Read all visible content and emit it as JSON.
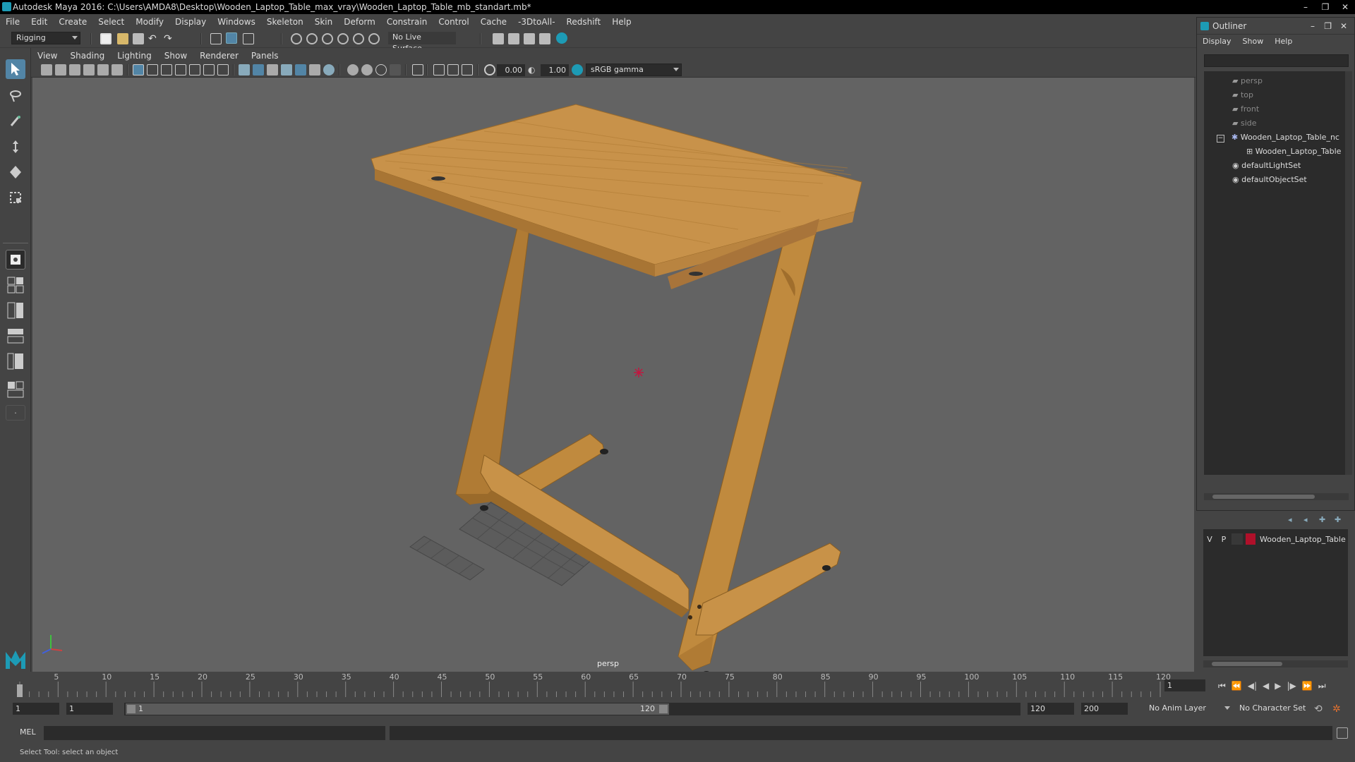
{
  "window": {
    "title": "Autodesk Maya 2016: C:\\Users\\AMDA8\\Desktop\\Wooden_Laptop_Table_max_vray\\Wooden_Laptop_Table_mb_standart.mb*",
    "minimize": "–",
    "maximize": "❐",
    "close": "✕"
  },
  "menubar": [
    "File",
    "Edit",
    "Create",
    "Select",
    "Modify",
    "Display",
    "Windows",
    "Skeleton",
    "Skin",
    "Deform",
    "Constrain",
    "Control",
    "Cache",
    "-3DtoAll-",
    "Redshift",
    "Help"
  ],
  "statusline": {
    "menu_set": "Rigging",
    "live_surface": "No Live Surface"
  },
  "viewport": {
    "menu": [
      "View",
      "Shading",
      "Lighting",
      "Show",
      "Renderer",
      "Panels"
    ],
    "exposure": "0.00",
    "gamma": "1.00",
    "color_space": "sRGB gamma",
    "camera_label": "persp"
  },
  "outliner": {
    "title": "Outliner",
    "menu": [
      "Display",
      "Show",
      "Help"
    ],
    "items": [
      {
        "label": "persp",
        "icon": "camera-icon",
        "dim": true
      },
      {
        "label": "top",
        "icon": "camera-icon",
        "dim": true
      },
      {
        "label": "front",
        "icon": "camera-icon",
        "dim": true
      },
      {
        "label": "side",
        "icon": "camera-icon",
        "dim": true
      },
      {
        "label": "Wooden_Laptop_Table_nc",
        "icon": "group-icon",
        "dim": false
      },
      {
        "label": "Wooden_Laptop_Table",
        "icon": "mesh-icon",
        "dim": false
      },
      {
        "label": "defaultLightSet",
        "icon": "set-icon",
        "dim": false
      },
      {
        "label": "defaultObjectSet",
        "icon": "set-icon",
        "dim": false
      }
    ]
  },
  "layers": {
    "v": "V",
    "p": "P",
    "layer_name": "Wooden_Laptop_Table",
    "layer_color": "#b0102a"
  },
  "timeslider": {
    "ticks": [
      "1",
      "5",
      "10",
      "15",
      "20",
      "25",
      "30",
      "35",
      "40",
      "45",
      "50",
      "55",
      "60",
      "65",
      "70",
      "75",
      "80",
      "85",
      "90",
      "95",
      "100",
      "105",
      "110",
      "115",
      "120"
    ],
    "current_frame": "1"
  },
  "range": {
    "start": "1",
    "playback_start": "1",
    "range_start_label": "1",
    "range_end_label": "120",
    "playback_end": "120",
    "end": "200",
    "anim_layer": "No Anim Layer",
    "character_set": "No Character Set"
  },
  "cmdline": {
    "label": "MEL"
  },
  "helpline": {
    "text": "Select Tool: select an object"
  },
  "colors": {
    "maya_bg": "#444444",
    "viewport_bg": "#636363",
    "accent": "#5285a6",
    "wood": "#c08a3e"
  }
}
